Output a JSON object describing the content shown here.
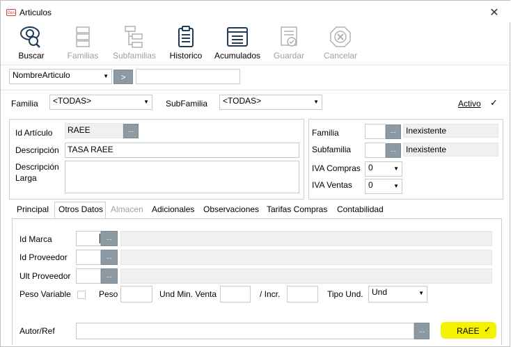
{
  "window": {
    "title": "Articulos",
    "close_glyph": "✕"
  },
  "toolbar": {
    "buscar": "Buscar",
    "familias": "Familias",
    "subfamilias": "Subfamilias",
    "historico": "Historico",
    "acumulados": "Acumulados",
    "guardar": "Guardar",
    "cancelar": "Cancelar"
  },
  "search": {
    "field": "NombreArticulo",
    "go": ">",
    "value": ""
  },
  "filters": {
    "familia_label": "Familia",
    "familia_value": "<TODAS>",
    "subfamilia_label": "SubFamilia",
    "subfamilia_value": "<TODAS>",
    "activo_label": "Activo",
    "activo_check": "✓"
  },
  "article": {
    "id_label": "Id Artículo",
    "id_value": "RAEE",
    "desc_label": "Descripción",
    "desc_value": "TASA RAEE",
    "desc_larga_label_1": "Descripción",
    "desc_larga_label_2": "Larga",
    "ellipsis": "..."
  },
  "right": {
    "familia_label": "Familia",
    "familia_value": "Inexistente",
    "subfamilia_label": "Subfamilia",
    "subfamilia_value": "Inexistente",
    "iva_compras_label": "IVA Compras",
    "iva_compras_value": "0",
    "iva_ventas_label": "IVA Ventas",
    "iva_ventas_value": "0"
  },
  "tabs": [
    {
      "label": "Principal"
    },
    {
      "label": "Otros Datos"
    },
    {
      "label": "Almacen"
    },
    {
      "label": "Adicionales"
    },
    {
      "label": "Observaciones"
    },
    {
      "label": "Tarifas Compras"
    },
    {
      "label": "Contabilidad"
    }
  ],
  "otros": {
    "id_marca": "Id Marca",
    "id_proveedor": "Id Proveedor",
    "ult_proveedor": "Ult Proveedor",
    "peso_variable": "Peso Variable",
    "peso": "Peso",
    "und_min_venta": "Und Min. Venta",
    "incr": "/ Incr.",
    "tipo_und": "Tipo Und.",
    "tipo_und_value": "Und",
    "autor_ref": "Autor/Ref",
    "raee_label": "RAEE",
    "raee_check": "✓"
  },
  "colors": {
    "accent": "#1f3a5a",
    "button_gray": "#8e9aa3",
    "highlight": "#f5f200"
  }
}
